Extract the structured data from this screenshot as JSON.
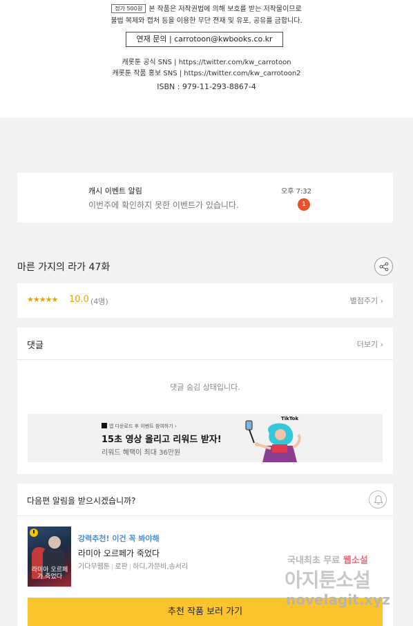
{
  "copyright": {
    "price_badge": "정가 500원",
    "line1": "본 작품은 저작권법에 의해 보호를 받는 저작물이므로",
    "line2": "불법 복제와 캡처 등을 이용한 무단 전재 및 유포, 공유를 금합니다.",
    "contact": "연재 문의 | carrotoon@kwbooks.co.kr",
    "sns1": "캐롯툰 공식 SNS | https://twitter.com/kw_carrotoon",
    "sns2": "캐롯툰 작품 홍보 SNS | https://twitter.com/kw_carrotoon2",
    "isbn": "ISBN : 979-11-293-8867-4"
  },
  "notification": {
    "title": "캐시 이벤트 알림",
    "message": "이번주에 확인하지 못한 이벤트가 있습니다.",
    "time": "오후 7:32",
    "badge_count": "1",
    "badge_color": "#e5532c"
  },
  "episode": {
    "title": "마른 가지의 라가 47화",
    "share_icon": "share-icon"
  },
  "rating": {
    "stars": "★★★★★",
    "score": "10.0",
    "count": "(4명)",
    "rate_link": "별점주기 ›",
    "accent_color": "#e5a20a"
  },
  "comments": {
    "title": "댓글",
    "more": "더보기 ›",
    "hidden_notice": "댓글 숨김 상태입니다."
  },
  "ad": {
    "small_text": "앱 다운로드 후 이벤트 참여하기 ›",
    "headline": "15초 영상 올리고 리워드 받자!",
    "subtext": "리워드 혜택이 최대 36만원",
    "brand": "TikTok"
  },
  "next_episode": {
    "question": "다음편 알림을 받으시겠습니까?",
    "bell_icon": "bell-icon",
    "recommend_tag": "강력추천! 이건 꼭 봐야해",
    "recommend_title": "라미아 오르페가 죽었다",
    "genre": "기다무웹툰",
    "category": "로판",
    "authors": "하디,가문비,송서리",
    "cover_title": "라미아 오르페가 죽었다",
    "button_label": "추천 작품 보러 가기",
    "button_color": "#fcc42b"
  },
  "watermark": {
    "line1_prefix": "국내최초 무료",
    "line1_highlight": "웹소설",
    "line2": "아지툰소설",
    "line3": "novelagit.xyz"
  }
}
